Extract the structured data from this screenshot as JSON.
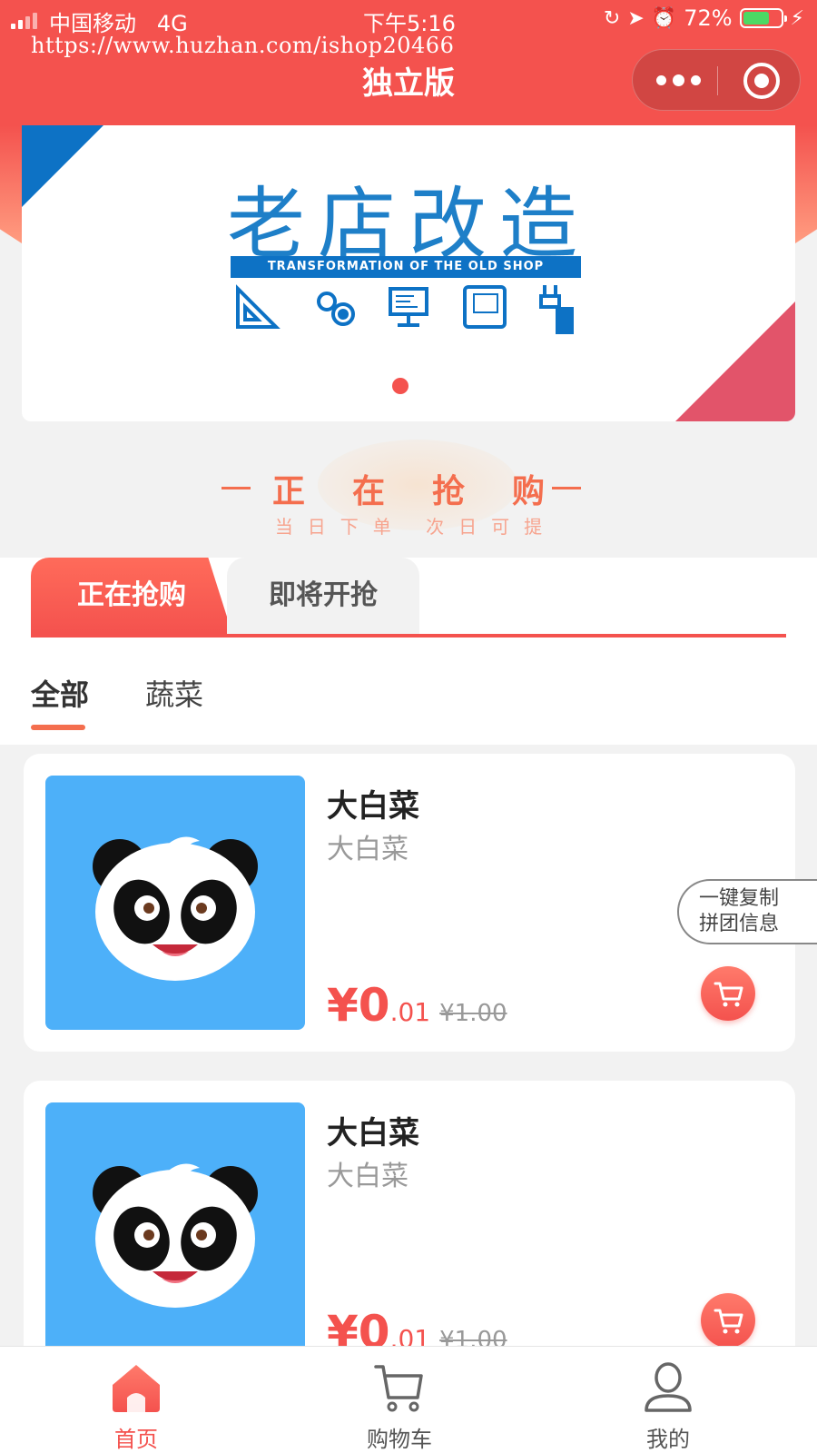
{
  "status_bar": {
    "carrier": "中国移动",
    "network": "4G",
    "time": "下午5:16",
    "battery": "72%",
    "battery_level": 0.72
  },
  "watermark": "https://www.huzhan.com/ishop20466",
  "nav": {
    "title": "独立版"
  },
  "banner": {
    "title": "老店改造",
    "subtitle": "TRANSFORMATION OF THE OLD SHOP",
    "icons": [
      "ruler-icon",
      "gears-icon",
      "monitor-icon",
      "blueprint-icon",
      "plug-icon"
    ],
    "slide_count": 1,
    "active_slide": 0
  },
  "section": {
    "heading": "正在抢购",
    "heading_chars": [
      "正",
      "在",
      "抢",
      "购"
    ],
    "subheading": "当日下单 次日可提"
  },
  "tabs": {
    "active": "正在抢购",
    "inactive": "即将开抢"
  },
  "categories": {
    "items": [
      "全部",
      "蔬菜"
    ],
    "selected": "全部"
  },
  "products": [
    {
      "name": "大白菜",
      "desc": "大白菜",
      "currency": "¥",
      "price_int": "0",
      "price_dec": ".01",
      "original_price": "¥1.00"
    },
    {
      "name": "大白菜",
      "desc": "大白菜",
      "currency": "¥",
      "price_int": "0",
      "price_dec": ".01",
      "original_price": "¥1.00"
    }
  ],
  "copy_button": {
    "line1": "一键复制",
    "line2": "拼团信息"
  },
  "tabbar": {
    "home": "首页",
    "cart": "购物车",
    "mine": "我的"
  },
  "colors": {
    "brand_red": "#f4524e",
    "sky_blue": "#4db0f9",
    "banner_blue": "#0d72c5",
    "accent_orange": "#f46e4e"
  }
}
